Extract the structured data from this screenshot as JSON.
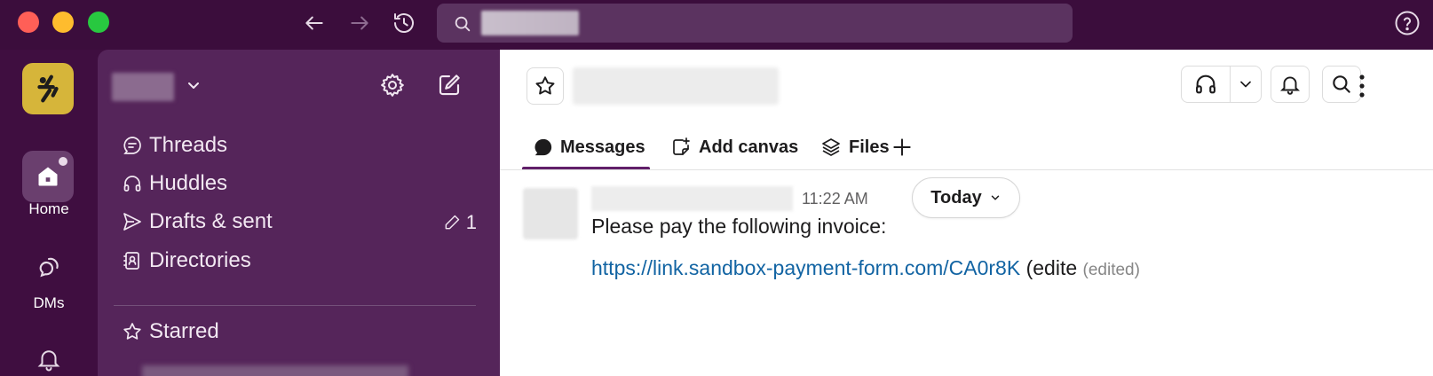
{
  "window": {
    "controls": [
      "close",
      "minimize",
      "zoom"
    ],
    "nav": {
      "back_icon": "arrow-left-icon",
      "forward_icon": "arrow-right-icon",
      "history_icon": "history-icon"
    },
    "search": {
      "value": ""
    },
    "help_icon": "help-icon"
  },
  "rail": {
    "items": [
      {
        "label": "Home",
        "icon": "home-icon"
      },
      {
        "label": "DMs",
        "icon": "dms-icon"
      },
      {
        "label": "",
        "icon": "bell-icon"
      }
    ]
  },
  "sidebar": {
    "workspace_name": "",
    "items": [
      {
        "label": "Threads",
        "icon": "threads-icon"
      },
      {
        "label": "Huddles",
        "icon": "headphones-icon"
      },
      {
        "label": "Drafts & sent",
        "icon": "send-icon",
        "badge": "1"
      },
      {
        "label": "Directories",
        "icon": "directory-icon"
      }
    ],
    "starred_label": "Starred"
  },
  "channel": {
    "name": "",
    "tabs": [
      {
        "label": "Messages",
        "icon": "message-icon",
        "active": true
      },
      {
        "label": "Add canvas",
        "icon": "canvas-icon"
      },
      {
        "label": "Files",
        "icon": "files-icon"
      }
    ]
  },
  "message": {
    "author": "",
    "time": "11:22 AM",
    "date_divider": "Today",
    "text": "Please pay the following invoice:",
    "link": "https://link.sandbox-payment-form.com/CA0r8K",
    "trailing": " (edite ",
    "edited": "(edited)"
  },
  "colors": {
    "titlebar": "#3b0d3c",
    "sidebar": "#55255a",
    "accent": "#611f69",
    "link": "#1264a3",
    "logo": "#d6b53a"
  }
}
